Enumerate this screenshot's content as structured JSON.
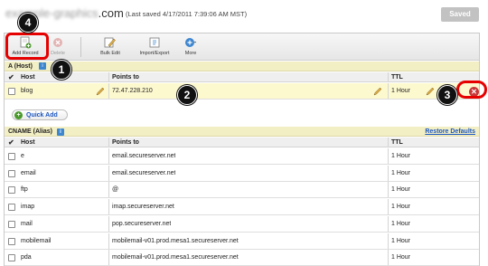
{
  "header": {
    "domain_hidden": "example-graphics",
    "domain_tld": ".com",
    "saved_info": "(Last saved 4/17/2011 7:39:06 AM MST)",
    "saved_button": "Saved"
  },
  "toolbar": {
    "items": [
      {
        "label": "Add Record",
        "icon": "add-record-icon",
        "enabled": true
      },
      {
        "label": "Delete",
        "icon": "delete-icon",
        "enabled": false
      },
      {
        "label": "Bulk Edit",
        "icon": "bulk-edit-icon",
        "enabled": true
      },
      {
        "label": "Import/Export",
        "icon": "import-export-icon",
        "enabled": true
      },
      {
        "label": "More",
        "icon": "more-icon",
        "enabled": true
      }
    ]
  },
  "a_section": {
    "title": "A (Host)",
    "columns": {
      "host": "Host",
      "points_to": "Points to",
      "ttl": "TTL"
    },
    "rows": [
      {
        "host": "blog",
        "points_to": "72.47.228.210",
        "ttl": "1 Hour"
      }
    ],
    "quick_add": "Quick Add"
  },
  "cname_section": {
    "title": "CNAME (Alias)",
    "restore_link": "Restore Defaults",
    "columns": {
      "host": "Host",
      "points_to": "Points to",
      "ttl": "TTL"
    },
    "rows": [
      {
        "host": "e",
        "points_to": "email.secureserver.net",
        "ttl": "1 Hour"
      },
      {
        "host": "email",
        "points_to": "email.secureserver.net",
        "ttl": "1 Hour"
      },
      {
        "host": "ftp",
        "points_to": "@",
        "ttl": "1 Hour"
      },
      {
        "host": "imap",
        "points_to": "imap.secureserver.net",
        "ttl": "1 Hour"
      },
      {
        "host": "mail",
        "points_to": "pop.secureserver.net",
        "ttl": "1 Hour"
      },
      {
        "host": "mobilemail",
        "points_to": "mobilemail-v01.prod.mesa1.secureserver.net",
        "ttl": "1 Hour"
      },
      {
        "host": "pda",
        "points_to": "mobilemail-v01.prod.mesa1.secureserver.net",
        "ttl": "1 Hour"
      }
    ]
  },
  "callouts": [
    "1",
    "2",
    "3",
    "4"
  ],
  "colors": {
    "highlight_row": "#fdf9cf",
    "section_header": "#f3efc4",
    "annotation_red": "#e60000",
    "link_blue": "#1b56c1"
  }
}
